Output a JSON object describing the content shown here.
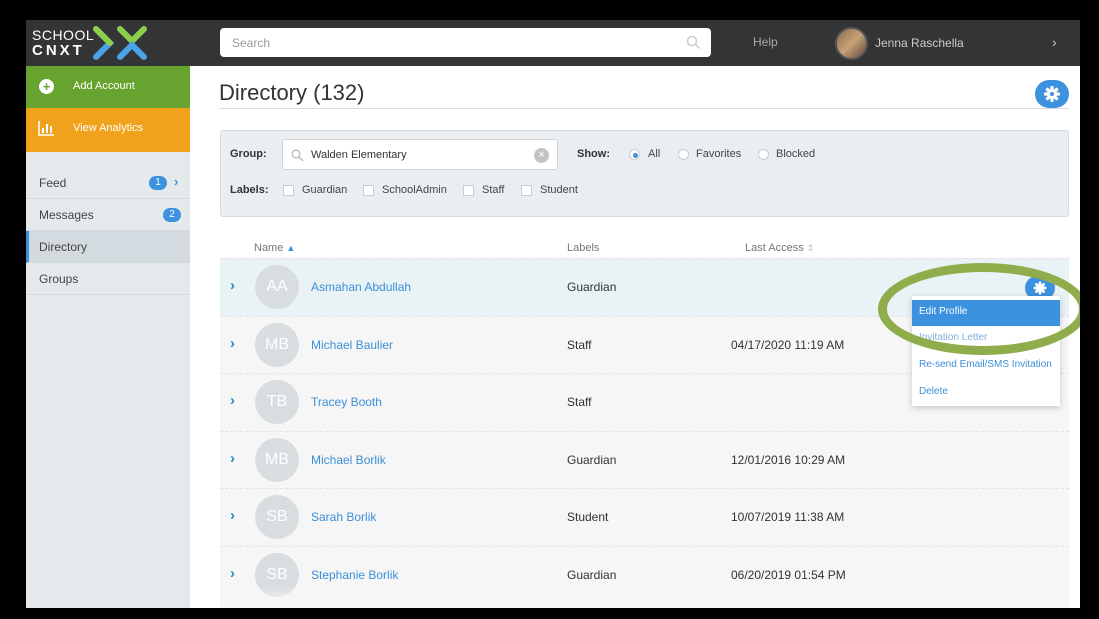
{
  "brand": {
    "line1": "SCHOOL",
    "line2": "CNXT"
  },
  "search": {
    "placeholder": "Search"
  },
  "header": {
    "help_label": "Help",
    "user_name": "Jenna Raschella"
  },
  "sidebar": {
    "add_account": "Add Account",
    "view_analytics": "View Analytics",
    "items": [
      {
        "label": "Feed",
        "badge": "1"
      },
      {
        "label": "Messages",
        "badge": "2"
      },
      {
        "label": "Directory",
        "badge": ""
      },
      {
        "label": "Groups",
        "badge": ""
      }
    ]
  },
  "page": {
    "title": "Directory (132)"
  },
  "filter": {
    "group_label": "Group:",
    "group_value": "Walden Elementary",
    "show_label": "Show:",
    "show_options": [
      "All",
      "Favorites",
      "Blocked"
    ],
    "show_selected": "All",
    "labels_label": "Labels:",
    "label_options": [
      "Guardian",
      "SchoolAdmin",
      "Staff",
      "Student"
    ]
  },
  "table": {
    "columns": {
      "name": "Name",
      "labels": "Labels",
      "last_access": "Last Access"
    },
    "rows": [
      {
        "initials": "AA",
        "name": "Asmahan Abdullah",
        "label": "Guardian",
        "last_access": ""
      },
      {
        "initials": "MB",
        "name": "Michael Baulier",
        "label": "Staff",
        "last_access": "04/17/2020 11:19 AM"
      },
      {
        "initials": "TB",
        "name": "Tracey Booth",
        "label": "Staff",
        "last_access": ""
      },
      {
        "initials": "MB",
        "name": "Michael Borlik",
        "label": "Guardian",
        "last_access": "12/01/2016 10:29 AM"
      },
      {
        "initials": "SB",
        "name": "Sarah Borlik",
        "label": "Student",
        "last_access": "10/07/2019 11:38 AM"
      },
      {
        "initials": "SB",
        "name": "Stephanie Borlik",
        "label": "Guardian",
        "last_access": "06/20/2019 01:54 PM"
      }
    ]
  },
  "row_menu": {
    "items": [
      "Edit Profile",
      "Invitation Letter",
      "Re-send Email/SMS Invitation",
      "Delete"
    ]
  },
  "colors": {
    "accent": "#3d92df",
    "add_green": "#67a32f",
    "analytics_orange": "#f0a21c",
    "highlight_ring": "#8fae4b"
  }
}
